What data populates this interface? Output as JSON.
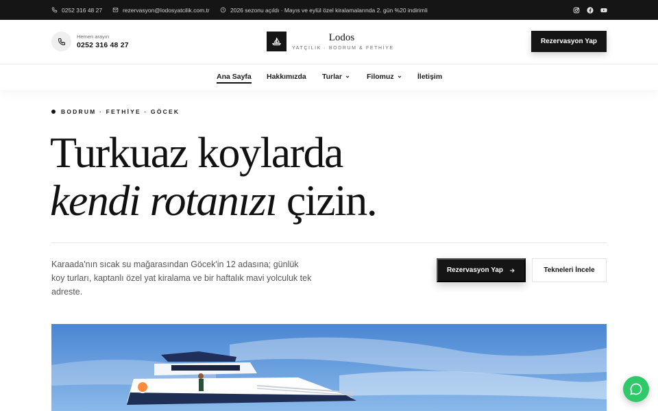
{
  "topbar": {
    "phone": "0252 316 48 27",
    "email": "rezervasyon@lodosyatcilik.com.tr",
    "notice": "2026 sezonu açıldı · Mayıs ve eylül özel kiralamalarında 2. gün %20 indirimli",
    "social": [
      "instagram-icon",
      "facebook-icon",
      "youtube-icon"
    ]
  },
  "header": {
    "call_label": "Hemen arayın",
    "call_number": "0252 316 48 27",
    "logo_name": "Lodos",
    "logo_tagline": "YATÇILIK · BODRUM & FETHİYE",
    "cta": "Rezervasyon Yap"
  },
  "nav": {
    "items": [
      {
        "label": "Ana Sayfa",
        "active": true
      },
      {
        "label": "Hakkımızda"
      },
      {
        "label": "Turlar",
        "dropdown": true
      },
      {
        "label": "Filomuz",
        "dropdown": true
      },
      {
        "label": "İletişim"
      }
    ]
  },
  "hero": {
    "eyebrow": "BODRUM · FETHİYE · GÖCEK",
    "title_line1": "Turkuaz koylarda",
    "title_line2_italic": "kendi rotanızı",
    "title_line2_rest": " çizin.",
    "lead": "Karaada'nın sıcak su mağarasından Göcek'in 12 adasına; günlük koy turları, kaptanlı özel yat kiralama ve bir haftalık mavi yolculuk tek adreste.",
    "primary_cta": "Rezervasyon Yap",
    "secondary_cta": "Tekneleri İncele"
  },
  "colors": {
    "dark": "#151515",
    "whatsapp": "#2fc96a",
    "sky": "#4f8fd8"
  }
}
